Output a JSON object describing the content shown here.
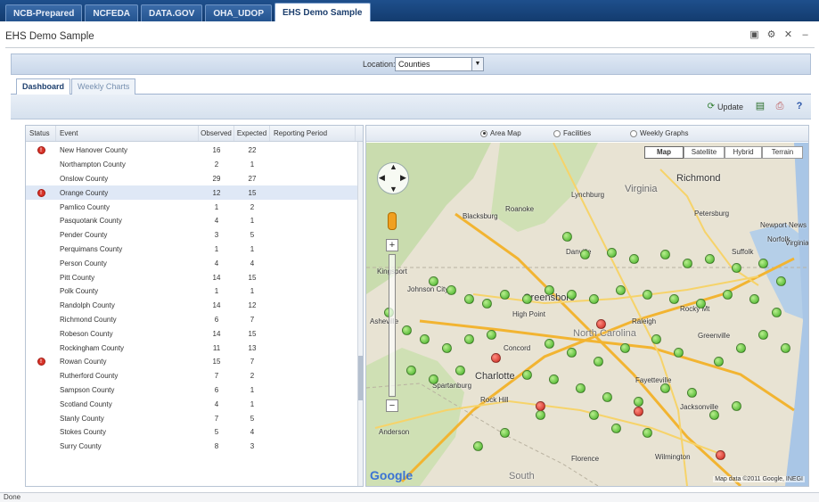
{
  "top_tabs": [
    {
      "label": "NCB-Prepared"
    },
    {
      "label": "NCFEDA"
    },
    {
      "label": "DATA.GOV"
    },
    {
      "label": "OHA_UDOP"
    },
    {
      "label": "EHS Demo Sample"
    }
  ],
  "window": {
    "title": "EHS Demo Sample"
  },
  "location": {
    "label": "Location:",
    "value": "Counties"
  },
  "subtabs": [
    {
      "label": "Dashboard"
    },
    {
      "label": "Weekly Charts"
    }
  ],
  "toolbar": {
    "update_label": "Update",
    "icons": [
      "export-icon",
      "print-icon",
      "help-icon"
    ]
  },
  "table": {
    "headers": {
      "status": "Status",
      "event": "Event",
      "observed": "Observed",
      "expected": "Expected",
      "reporting_period": "Reporting Period"
    },
    "rows": [
      {
        "alert": true,
        "event": "New Hanover County",
        "observed": "16",
        "expected": "22"
      },
      {
        "alert": false,
        "event": "Northampton County",
        "observed": "2",
        "expected": "1"
      },
      {
        "alert": false,
        "event": "Onslow County",
        "observed": "29",
        "expected": "27"
      },
      {
        "alert": true,
        "event": "Orange County",
        "observed": "12",
        "expected": "15",
        "selected": true
      },
      {
        "alert": false,
        "event": "Pamlico County",
        "observed": "1",
        "expected": "2"
      },
      {
        "alert": false,
        "event": "Pasquotank County",
        "observed": "4",
        "expected": "1"
      },
      {
        "alert": false,
        "event": "Pender County",
        "observed": "3",
        "expected": "5"
      },
      {
        "alert": false,
        "event": "Perquimans County",
        "observed": "1",
        "expected": "1"
      },
      {
        "alert": false,
        "event": "Person County",
        "observed": "4",
        "expected": "4"
      },
      {
        "alert": false,
        "event": "Pitt County",
        "observed": "14",
        "expected": "15"
      },
      {
        "alert": false,
        "event": "Polk County",
        "observed": "1",
        "expected": "1"
      },
      {
        "alert": false,
        "event": "Randolph County",
        "observed": "14",
        "expected": "12"
      },
      {
        "alert": false,
        "event": "Richmond County",
        "observed": "6",
        "expected": "7"
      },
      {
        "alert": false,
        "event": "Robeson County",
        "observed": "14",
        "expected": "15"
      },
      {
        "alert": false,
        "event": "Rockingham County",
        "observed": "11",
        "expected": "13"
      },
      {
        "alert": true,
        "event": "Rowan County",
        "observed": "15",
        "expected": "7"
      },
      {
        "alert": false,
        "event": "Rutherford County",
        "observed": "7",
        "expected": "2"
      },
      {
        "alert": false,
        "event": "Sampson County",
        "observed": "6",
        "expected": "1"
      },
      {
        "alert": false,
        "event": "Scotland County",
        "observed": "4",
        "expected": "1"
      },
      {
        "alert": false,
        "event": "Stanly County",
        "observed": "7",
        "expected": "5"
      },
      {
        "alert": false,
        "event": "Stokes County",
        "observed": "5",
        "expected": "4"
      },
      {
        "alert": false,
        "event": "Surry County",
        "observed": "8",
        "expected": "3"
      }
    ]
  },
  "map": {
    "view_options": [
      {
        "label": "Area Map",
        "selected": true
      },
      {
        "label": "Facilities",
        "selected": false
      },
      {
        "label": "Weekly Graphs",
        "selected": false
      }
    ],
    "map_types": [
      {
        "label": "Map",
        "active": true
      },
      {
        "label": "Satellite",
        "active": false
      },
      {
        "label": "Hybrid",
        "active": false
      },
      {
        "label": "Terrain",
        "active": false
      }
    ],
    "place_labels": {
      "richmond": "Richmond",
      "virginia": "Virginia",
      "lynchburg": "Lynchburg",
      "roanoke": "Roanoke",
      "blacksburg": "Blacksburg",
      "petersburg": "Petersburg",
      "danville": "Danville",
      "greensboro": "Greensboro",
      "high_point": "High Point",
      "north_carolina": "North Carolina",
      "raleigh": "Raleigh",
      "rocky_mt": "Rocky Mt",
      "greenville": "Greenville",
      "charlotte": "Charlotte",
      "concord": "Concord",
      "fayetteville": "Fayetteville",
      "spartanburg": "Spartanburg",
      "rock_hill": "Rock Hill",
      "anderson": "Anderson",
      "wilmington": "Wilmington",
      "florence": "Florence",
      "south": "South",
      "norfolk": "Norfolk",
      "newport_news": "Newport News",
      "virginia_beach": "Virginia Beach",
      "suffolk": "Suffolk",
      "jacksonville": "Jacksonville",
      "kingsport": "Kingsport",
      "johnson_city": "Johnson City",
      "asheville": "Asheville"
    },
    "green_pins": 60,
    "red_pins": 5,
    "brand": "Google",
    "attribution": "Map data ©2011 Google, INEGI"
  },
  "status": {
    "text": "Done"
  }
}
